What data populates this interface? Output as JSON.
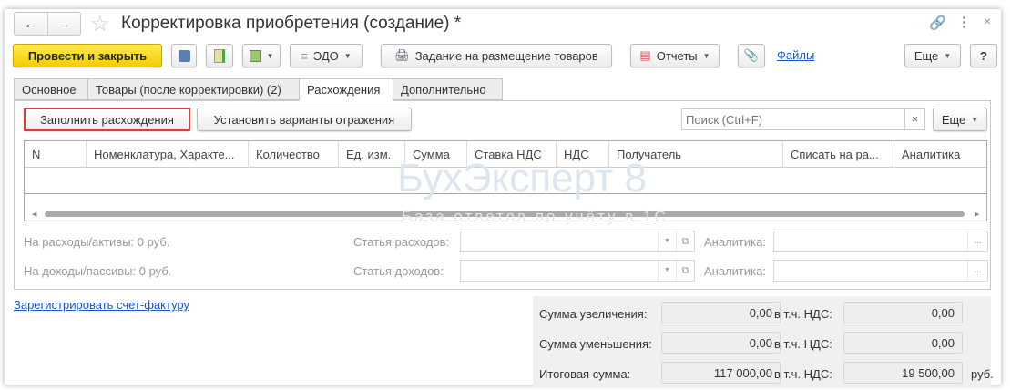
{
  "title": "Корректировка приобретения (создание) *",
  "toolbar": {
    "post_close": "Провести и закрыть",
    "edo": "ЭДО",
    "task": "Задание на размещение товаров",
    "reports": "Отчеты",
    "files": "Файлы",
    "more": "Еще",
    "help": "?"
  },
  "tabs": [
    {
      "label": "Основное"
    },
    {
      "label": "Товары (после корректировки) (2)"
    },
    {
      "label": "Расхождения"
    },
    {
      "label": "Дополнительно"
    }
  ],
  "panel": {
    "fill": "Заполнить расхождения",
    "set_variants": "Установить варианты отражения",
    "search_placeholder": "Поиск (Ctrl+F)",
    "clear": "×",
    "more": "Еще"
  },
  "table": {
    "columns": [
      "N",
      "Номенклатура, Характе...",
      "Количество",
      "Ед. изм.",
      "Сумма",
      "Ставка НДС",
      "НДС",
      "Получатель",
      "Списать на ра...",
      "Аналитика"
    ]
  },
  "fields": {
    "expenses": "На расходы/активы: 0 руб.",
    "income": "На доходы/пассивы: 0 руб.",
    "expense_item": "Статья расходов:",
    "income_item": "Статья доходов:",
    "analytics": "Аналитика:",
    "ellipsis": "..."
  },
  "link": "Зарегистрировать счет-фактуру",
  "totals": {
    "increase_label": "Сумма увеличения:",
    "increase": "0,00",
    "increase_vat": "0,00",
    "decrease_label": "Сумма уменьшения:",
    "decrease": "0,00",
    "decrease_vat": "0,00",
    "total_label": "Итоговая сумма:",
    "total": "117 000,00",
    "total_vat": "19 500,00",
    "vat_label": "в т.ч. НДС:",
    "currency": "руб."
  },
  "watermark": {
    "brand": "БухЭксперт 8",
    "tagline": "База ответов по учёту в 1С"
  }
}
